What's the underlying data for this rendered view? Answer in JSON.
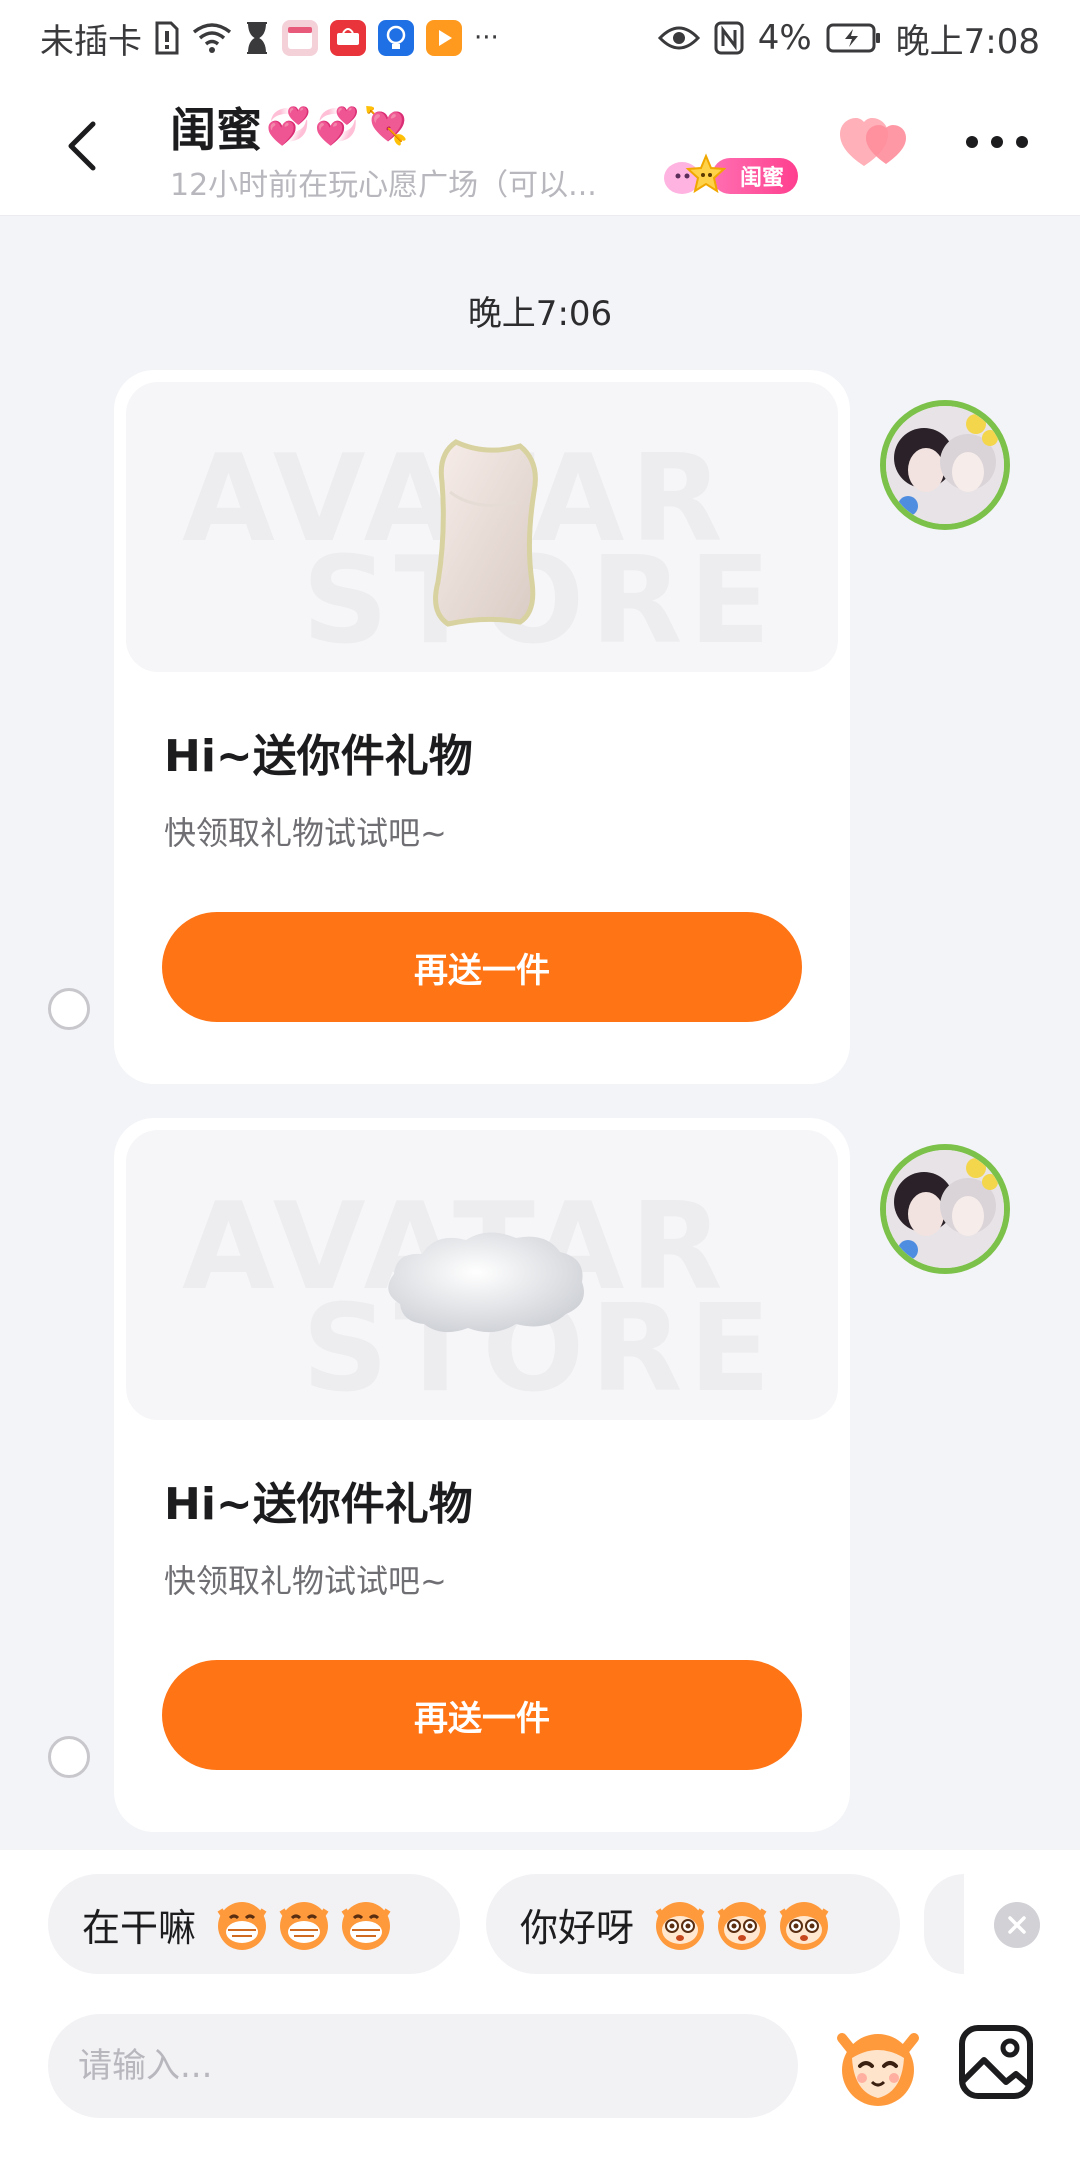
{
  "status_bar": {
    "sim_text": "未插卡",
    "battery_percent": "4%",
    "time": "晚上7:08",
    "ellipsis": "···"
  },
  "header": {
    "contact_name": "闺蜜",
    "name_emojis": [
      "💞",
      "💞",
      "💘"
    ],
    "status_line": "12小时前在玩心愿广场（可以...",
    "relation_badge": "闺蜜"
  },
  "chat": {
    "timestamp": "晚上7:06",
    "messages": [
      {
        "gift_name_icon": "pillow-gift-icon",
        "watermark_top": "AVATAR",
        "watermark_bottom": "STORE",
        "title": "Hi~送你件礼物",
        "subtitle": "快领取礼物试试吧~",
        "button_label": "再送一件"
      },
      {
        "gift_name_icon": "cloud-gift-icon",
        "watermark_top": "AVATAR",
        "watermark_bottom": "STORE",
        "title": "Hi~送你件礼物",
        "subtitle": "快领取礼物试试吧~",
        "button_label": "再送一件"
      }
    ]
  },
  "quick_replies": [
    {
      "text": "在干嘛",
      "emoji_icon": "grinning-mascot-icon"
    },
    {
      "text": "你好呀",
      "emoji_icon": "surprised-mascot-icon"
    }
  ],
  "input": {
    "placeholder": "请输入..."
  },
  "colors": {
    "accent_orange": "#ff7415",
    "badge_pink": "#ff3f8f",
    "background": "#f3f4f8"
  }
}
